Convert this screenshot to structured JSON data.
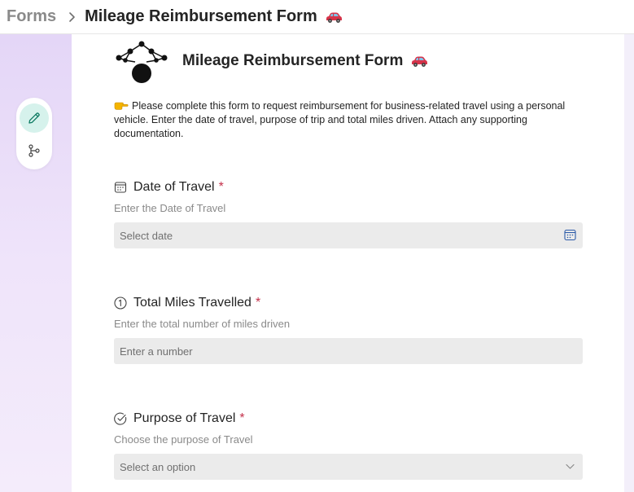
{
  "breadcrumb": {
    "root": "Forms",
    "current": "Mileage Reimbursement Form"
  },
  "form": {
    "title": "Mileage Reimbursement Form",
    "intro": "Please complete this form to request reimbursement for business-related travel using a personal vehicle. Enter the date of travel, purpose of trip and total miles driven. Attach any supporting documentation."
  },
  "questions": [
    {
      "label": "Date of Travel",
      "required": "*",
      "subtitle": "Enter the Date of Travel",
      "placeholder": "Select date",
      "icon": "calendar-icon"
    },
    {
      "label": "Total Miles Travelled",
      "required": "*",
      "subtitle": "Enter the total number of miles driven",
      "placeholder": "Enter a number",
      "icon": "number-one-icon"
    },
    {
      "label": "Purpose of Travel",
      "required": "*",
      "subtitle": "Choose the purpose of Travel",
      "placeholder": "Select an option",
      "icon": "choice-check-icon"
    }
  ],
  "toolrail": {
    "tools": [
      "edit-pencil-icon",
      "branching-icon"
    ]
  },
  "colors": {
    "accent_teal": "#d6f2ec",
    "required_red": "#c4314b",
    "field_bg": "#ebebeb",
    "calendar_icon_blue": "#2b5aa8",
    "sidebar_lavender": "#e4d6f7"
  }
}
